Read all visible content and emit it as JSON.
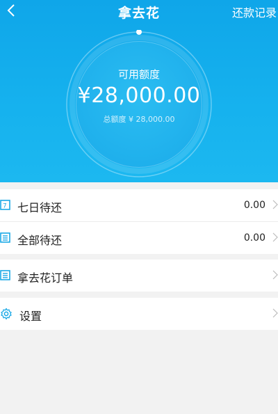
{
  "header": {
    "title": "拿去花",
    "record_label": "还款记录"
  },
  "credit": {
    "available_label": "可用额度",
    "available_amount": "¥28,000.00",
    "total_text": "总额度 ¥ 28,000.00"
  },
  "bills": [
    {
      "label": "七日待还",
      "value": "0.00",
      "icon": "calendar-7-icon"
    },
    {
      "label": "全部待还",
      "value": "0.00",
      "icon": "list-icon"
    }
  ],
  "orders": {
    "label": "拿去花订单",
    "icon": "order-list-icon"
  },
  "settings": {
    "label": "设置",
    "icon": "gear-icon"
  },
  "colors": {
    "accent": "#13aeec",
    "page_bg": "#f2f2f2"
  }
}
